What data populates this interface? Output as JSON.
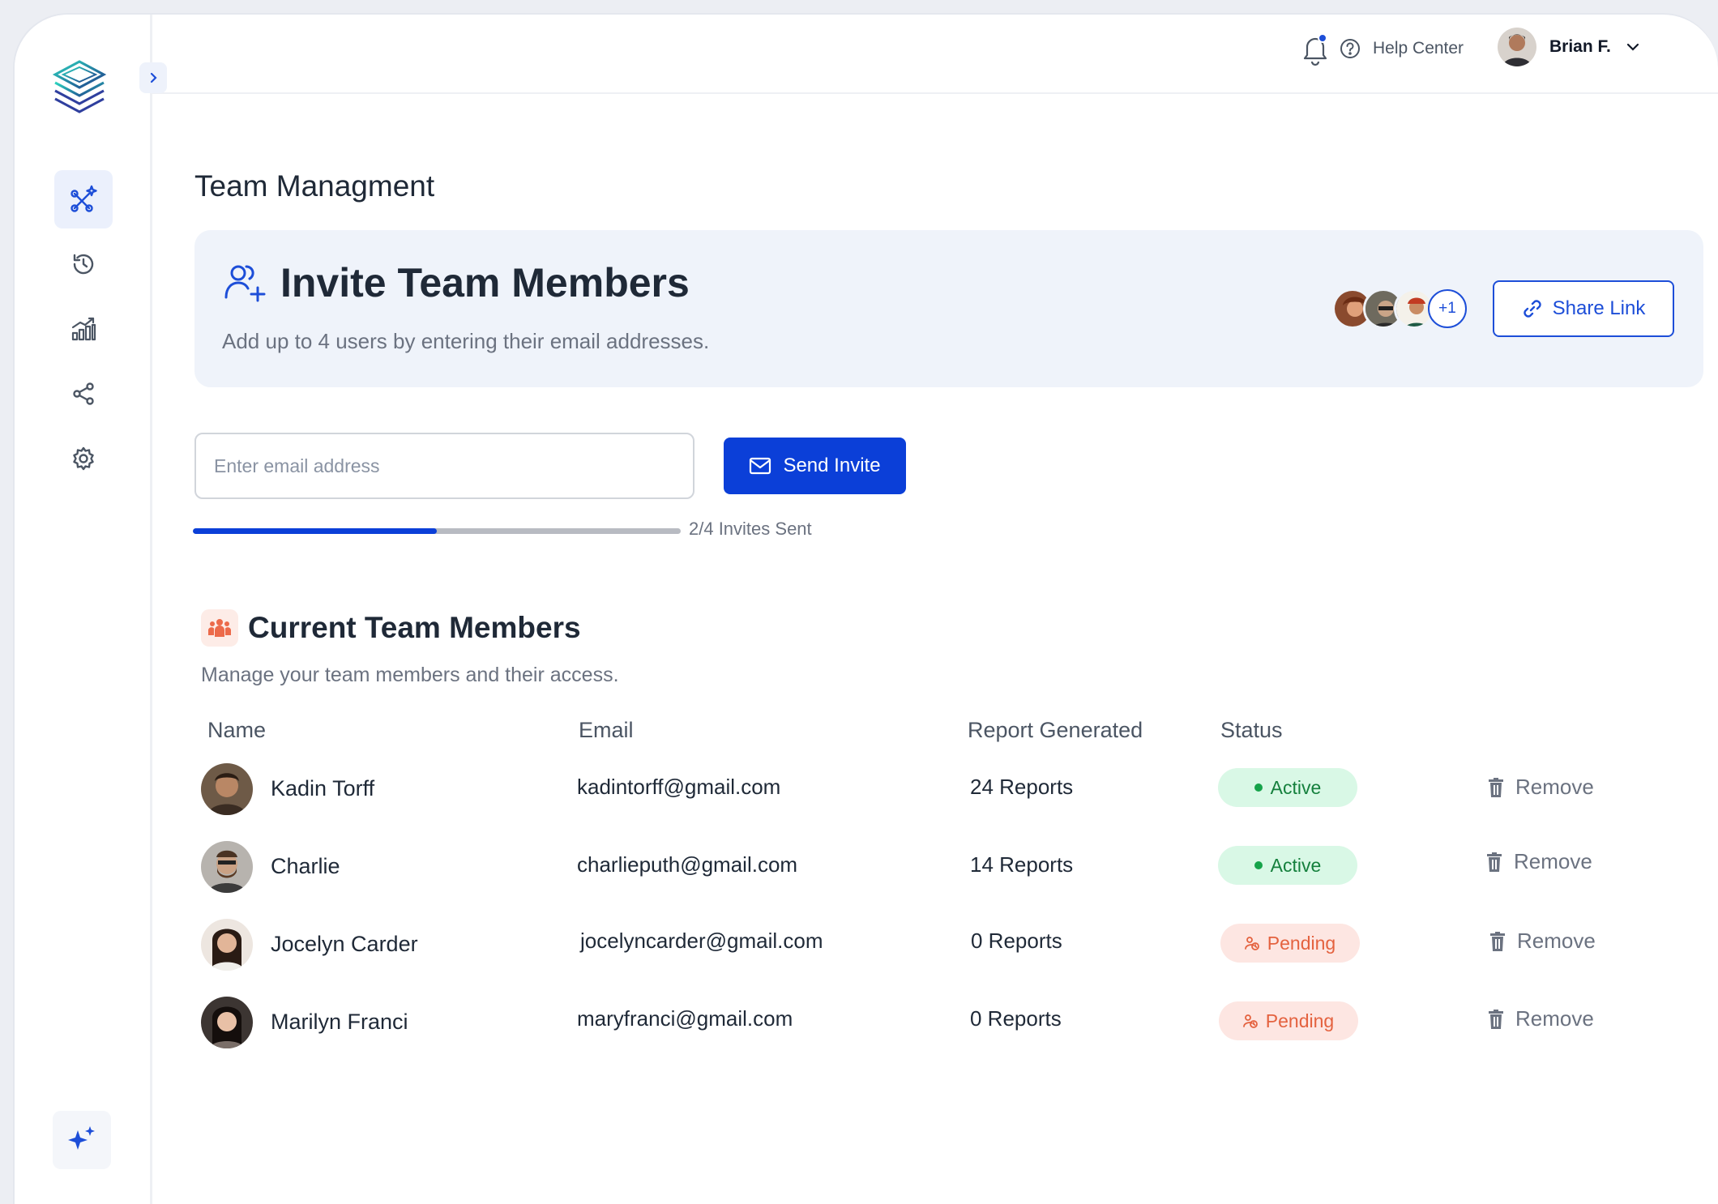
{
  "header": {
    "help_label": "Help Center",
    "user_name": "Brian F."
  },
  "page": {
    "title": "Team Managment"
  },
  "invite": {
    "title": "Invite Team Members",
    "subtitle": "Add up to 4 users by entering their email addresses.",
    "avatar_more": "+1",
    "share_label": "Share Link",
    "email_placeholder": "Enter email address",
    "email_value": "",
    "send_label": "Send Invite",
    "progress_text": "2/4 Invites Sent",
    "progress_fraction": 0.5
  },
  "members": {
    "title": "Current Team Members",
    "subtitle": "Manage your team members and their access.",
    "columns": {
      "name": "Name",
      "email": "Email",
      "reports": "Report Generated",
      "status": "Status"
    },
    "rows": [
      {
        "name": "Kadin Torff",
        "email": "kadintorff@gmail.com",
        "reports": "24 Reports",
        "status": "Active",
        "remove": "Remove"
      },
      {
        "name": "Charlie",
        "email": "charlieputh@gmail.com",
        "reports": "14 Reports",
        "status": "Active",
        "remove": "Remove"
      },
      {
        "name": "Jocelyn Carder",
        "email": "jocelyncarder@gmail.com",
        "reports": "0 Reports",
        "status": "Pending",
        "remove": "Remove"
      },
      {
        "name": "Marilyn Franci",
        "email": "maryfranci@gmail.com",
        "reports": "0 Reports",
        "status": "Pending",
        "remove": "Remove"
      }
    ]
  },
  "sidebar": {
    "items": [
      {
        "icon": "ai-tools-icon",
        "active": true
      },
      {
        "icon": "history-icon",
        "active": false
      },
      {
        "icon": "analytics-icon",
        "active": false
      },
      {
        "icon": "share-icon",
        "active": false
      },
      {
        "icon": "settings-icon",
        "active": false
      }
    ],
    "bottom_icon": "sparkle-icon"
  },
  "colors": {
    "primary": "#0B3FD8",
    "active_bg": "#D9F8E6",
    "active_text": "#15803D",
    "pending_bg": "#FDE6E2",
    "pending_text": "#E4623F",
    "card_bg": "#EFF3FA"
  }
}
